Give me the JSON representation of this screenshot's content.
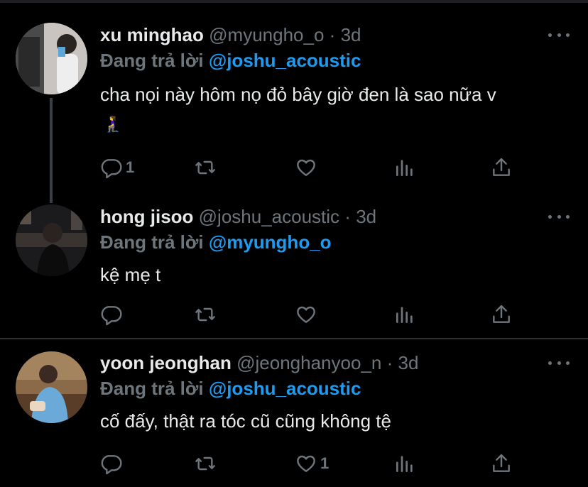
{
  "tweets": [
    {
      "name": "xu minghao",
      "handle": "@myungho_o",
      "dot": "·",
      "time": "3d",
      "reply_prefix": "Đang trả lời",
      "reply_to": "@joshu_acoustic",
      "text": "cha nọi này hôm nọ đỏ bây giờ đen là sao nữa v",
      "emoji": "🧎‍♀️",
      "reply_count": "1",
      "like_count": ""
    },
    {
      "name": "hong jisoo",
      "handle": "@joshu_acoustic",
      "dot": "·",
      "time": "3d",
      "reply_prefix": "Đang trả lời",
      "reply_to": "@myungho_o",
      "text": "kệ mẹ t",
      "reply_count": "",
      "like_count": ""
    },
    {
      "name": "yoon jeonghan",
      "handle": "@jeonghanyoo_n",
      "dot": "·",
      "time": "3d",
      "reply_prefix": "Đang trả lời",
      "reply_to": "@joshu_acoustic",
      "text": "cố đấy, thật ra tóc cũ cũng không tệ",
      "reply_count": "",
      "like_count": "1"
    }
  ],
  "icons": {
    "reply": "reply-icon",
    "retweet": "retweet-icon",
    "like": "heart-icon",
    "views": "analytics-icon",
    "share": "share-icon",
    "more": "more-icon"
  },
  "colors": {
    "background": "#000000",
    "accent": "#1d9bf0",
    "muted": "#6e767d",
    "text": "#e7e9ea"
  }
}
